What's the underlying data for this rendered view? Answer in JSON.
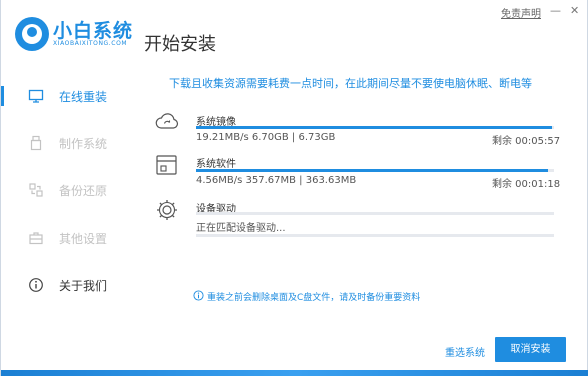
{
  "header": {
    "brand_name": "小白系统",
    "brand_sub": "XIAOBAIXITONG.COM",
    "page_title": "开始安装",
    "disclaimer": "免责声明",
    "minimize": "—",
    "close": "✕"
  },
  "sidebar": {
    "items": [
      {
        "label": "在线重装",
        "icon": "monitor-icon",
        "state": "active"
      },
      {
        "label": "制作系统",
        "icon": "usb-icon",
        "state": "disabled"
      },
      {
        "label": "备份还原",
        "icon": "backup-icon",
        "state": "disabled"
      },
      {
        "label": "其他设置",
        "icon": "toolbox-icon",
        "state": "disabled"
      },
      {
        "label": "关于我们",
        "icon": "info-icon",
        "state": "normal"
      }
    ]
  },
  "main": {
    "notice": "下载且收集资源需要耗费一点时间，在此期间尽量不要使电脑休眠、断电等",
    "tasks": [
      {
        "name": "系统镜像",
        "stats": "19.21MB/s 6.70GB | 6.73GB",
        "remaining": "剩余 00:05:57",
        "progress": 0.995,
        "icon": "cloud-sync-icon"
      },
      {
        "name": "系统软件",
        "stats": "4.56MB/s 357.67MB | 363.63MB",
        "remaining": "剩余 00:01:18",
        "progress": 0.984,
        "icon": "software-box-icon"
      },
      {
        "name": "设备驱动",
        "stats": "正在匹配设备驱动...",
        "remaining": "",
        "progress": 0.0,
        "icon": "gear-icon"
      }
    ],
    "warning": "重装之前会删除桌面及C盘文件，请及时备份重要资料"
  },
  "footer": {
    "reselect": "重选系统",
    "cancel": "取消安装"
  },
  "colors": {
    "accent": "#1f8de0",
    "disabled": "#c3c3c3",
    "track": "#e6e9ee"
  }
}
